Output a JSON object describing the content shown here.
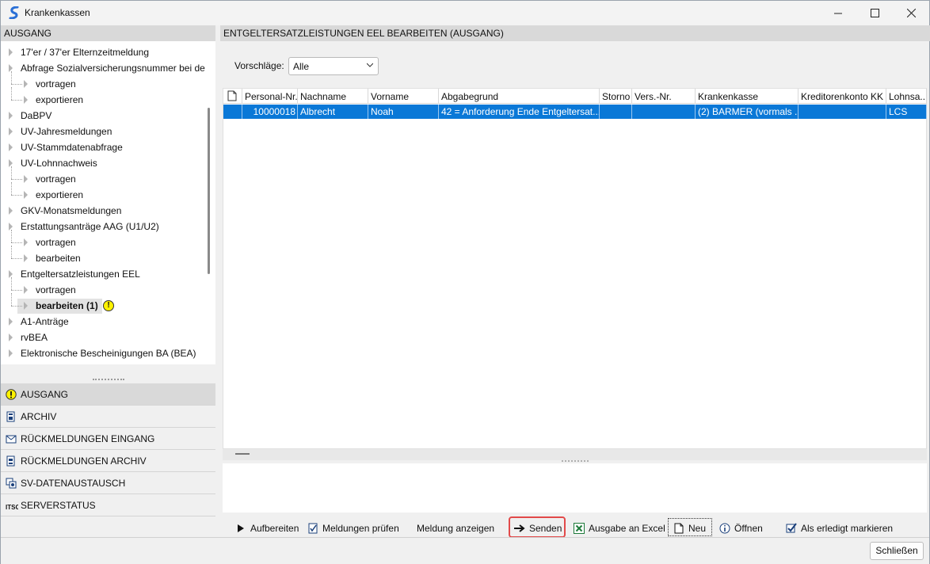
{
  "window": {
    "title": "Krankenkassen"
  },
  "left": {
    "header": "AUSGANG",
    "tree": [
      {
        "label": "17'er / 37'er Elternzeitmeldung",
        "level": 0
      },
      {
        "label": "Abfrage Sozialversicherungsnummer bei de",
        "level": 0
      },
      {
        "label": "vortragen",
        "level": 1
      },
      {
        "label": "exportieren",
        "level": 1
      },
      {
        "label": "DaBPV",
        "level": 0
      },
      {
        "label": "UV-Jahresmeldungen",
        "level": 0
      },
      {
        "label": "UV-Stammdatenabfrage",
        "level": 0
      },
      {
        "label": "UV-Lohnnachweis",
        "level": 0
      },
      {
        "label": "vortragen",
        "level": 1
      },
      {
        "label": "exportieren",
        "level": 1
      },
      {
        "label": "GKV-Monatsmeldungen",
        "level": 0
      },
      {
        "label": "Erstattungsanträge AAG (U1/U2)",
        "level": 0
      },
      {
        "label": "vortragen",
        "level": 1
      },
      {
        "label": "bearbeiten",
        "level": 1
      },
      {
        "label": "Entgeltersatzleistungen EEL",
        "level": 0
      },
      {
        "label": "vortragen",
        "level": 1
      },
      {
        "label": "bearbeiten (1)",
        "level": 1,
        "selected": true,
        "warning": true
      },
      {
        "label": "A1-Anträge",
        "level": 0
      },
      {
        "label": "rvBEA",
        "level": 0
      },
      {
        "label": "Elektronische Bescheinigungen BA (BEA)",
        "level": 0
      }
    ],
    "nav": [
      {
        "label": "AUSGANG",
        "icon": "warning-icon",
        "active": true
      },
      {
        "label": "ARCHIV",
        "icon": "archive-icon"
      },
      {
        "label": "RÜCKMELDUNGEN EINGANG",
        "icon": "mail-in-icon"
      },
      {
        "label": "RÜCKMELDUNGEN ARCHIV",
        "icon": "mail-archive-icon"
      },
      {
        "label": "SV-DATENAUSTAUSCH",
        "icon": "data-exchange-icon"
      },
      {
        "label": "SERVERSTATUS",
        "icon": "server-status-icon"
      }
    ]
  },
  "right": {
    "header": "ENTGELTERSATZLEISTUNGEN EEL BEARBEITEN (AUSGANG)",
    "filter": {
      "label": "Vorschläge:",
      "value": "Alle"
    },
    "grid": {
      "columns": [
        "Personal-Nr.",
        "Nachname",
        "Vorname",
        "Abgabegrund",
        "Storno",
        "Vers.-Nr.",
        "Krankenkasse",
        "Kreditorenkonto KK",
        "Lohnsa..."
      ],
      "rows": [
        [
          "10000018",
          "Albrecht",
          "Noah",
          "42 = Anforderung Ende Entgeltersat...",
          "",
          "",
          "(2) BARMER (vormals ...",
          "",
          "LCS"
        ]
      ]
    },
    "toolbar": {
      "aufbereiten": "Aufbereiten",
      "pruefen": "Meldungen prüfen",
      "anzeigen": "Meldung anzeigen",
      "senden": "Senden",
      "excel": "Ausgabe an Excel",
      "neu": "Neu",
      "oeffnen": "Öffnen",
      "erledigt": "Als erledigt markieren"
    }
  },
  "footer": {
    "close": "Schließen"
  },
  "colors": {
    "selection": "#0a78d7",
    "warning": "#fff200",
    "highlight": "#e24a4a",
    "excel": "#1d7a3a"
  }
}
